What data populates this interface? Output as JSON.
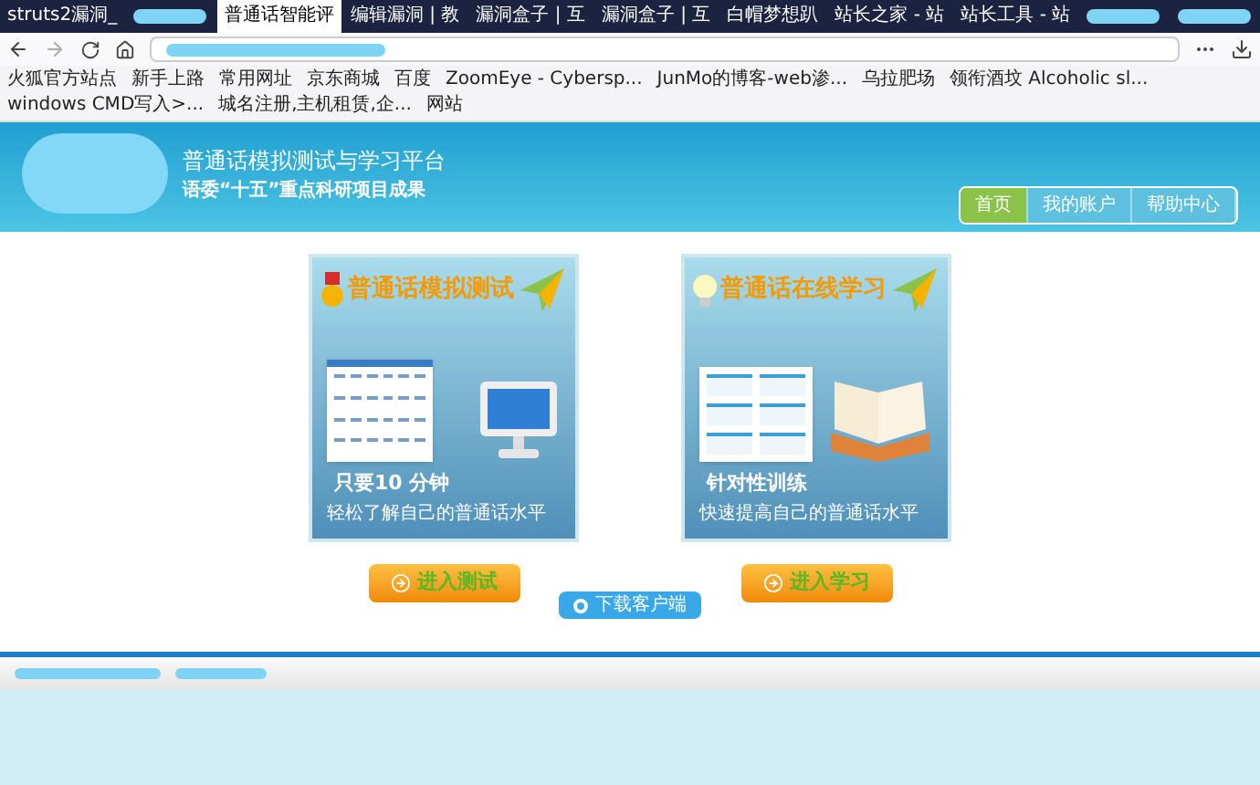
{
  "browser_tabs": [
    {
      "label": "struts2漏洞_",
      "selected": false
    },
    {
      "kind": "redacted",
      "selected": false
    },
    {
      "label": "普通话智能评",
      "selected": true
    },
    {
      "label": "编辑漏洞 | 教",
      "selected": false
    },
    {
      "label": "漏洞盒子 | 互",
      "selected": false
    },
    {
      "label": "漏洞盒子 | 互",
      "selected": false
    },
    {
      "label": "白帽梦想趴",
      "selected": false
    },
    {
      "label": "站长之家 - 站",
      "selected": false
    },
    {
      "label": "站长工具 - 站",
      "selected": false
    },
    {
      "kind": "redacted",
      "selected": false
    },
    {
      "kind": "redacted",
      "selected": false
    }
  ],
  "bookmarks": [
    "火狐官方站点",
    "新手上路",
    "常用网址",
    "京东商城",
    "百度",
    "ZoomEye - Cybersp...",
    "JunMo的博客-web渗...",
    "乌拉肥场",
    "领衔酒坟 Alcoholic sl...",
    "windows CMD写入>...",
    "城名注册,主机租赁,企...",
    "网站"
  ],
  "header": {
    "title": "普通话模拟测试与学习平台",
    "subtitle": "语委“十五”重点科研项目成果"
  },
  "nav": [
    {
      "label": "首页",
      "selected": true
    },
    {
      "label": "我的账户",
      "selected": false
    },
    {
      "label": "帮助中心",
      "selected": false
    }
  ],
  "cards": [
    {
      "kind": "test",
      "title": "普通话模拟测试",
      "headline": "只要10 分钟",
      "text": "轻松了解自己的普通话水平",
      "button": "进入测试"
    },
    {
      "kind": "study",
      "title": "普通话在线学习",
      "headline": "针对性训练",
      "text": "快速提高自己的普通话水平",
      "button": "进入学习"
    }
  ],
  "download_button": "下载客户端"
}
